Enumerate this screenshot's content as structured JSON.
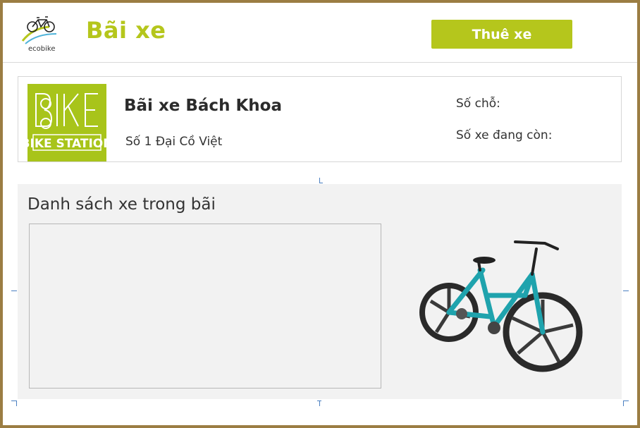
{
  "header": {
    "logo_text": "ecobike",
    "title": "Bãi xe",
    "rent_button_label": "Thuê xe"
  },
  "station": {
    "logo_text": "BIKE STATION",
    "name": "Bãi xe Bách Khoa",
    "address": "Số 1 Đại Cồ Việt",
    "slots_label": "Số chỗ:",
    "available_label": "Số xe đang còn:"
  },
  "bike_list": {
    "title": "Danh sách xe trong bãi",
    "items": []
  },
  "colors": {
    "accent": "#b5c61c",
    "frame": "#9b7d43",
    "panel": "#f2f2f2",
    "bike_frame": "#1fa3ad"
  },
  "icons": [
    "ecobike-logo-icon",
    "bike-station-logo-icon",
    "bicycle-image"
  ]
}
